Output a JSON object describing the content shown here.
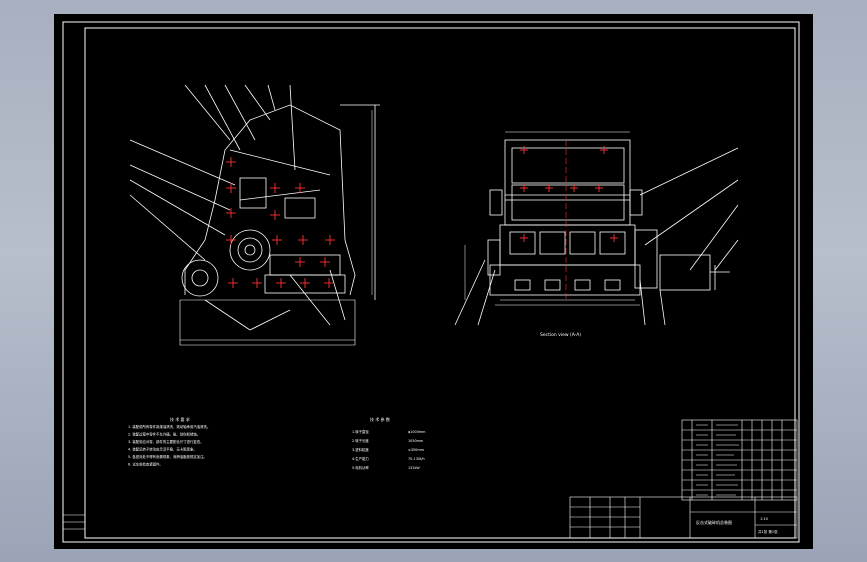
{
  "app": {
    "background_colors": [
      "#a8b0c0",
      "#9aa4b6"
    ],
    "paper_color": "#000000",
    "line_color": "#ffffff",
    "accent_color": "#ff3030"
  },
  "drawing": {
    "section_view_caption": "Section view (A-A)",
    "tech_requirements_title": "技 术 要 求",
    "tech_params_title": "技 术 参 数",
    "tech_requirements": [
      "1. 装配前所有零件用煤油清洗，滚动轴承用汽油清洗。",
      "2. 装配过程中零件不允许磕、碰、划伤和锈蚀。",
      "3. 装配前应对零、部件的主要配合尺寸进行复查。",
      "4. 装配后转子转动应灵活平稳，无卡阻现象。",
      "5. 各密封处不得有渗漏现象，润滑油脂按规定加注。",
      "6. 试车前检查紧固件。"
    ],
    "tech_params": [
      {
        "label": "1.转子直径",
        "value": "φ1000mm"
      },
      {
        "label": "2.转子长度",
        "value": "1050mm"
      },
      {
        "label": "3.进料粒度",
        "value": "≤350mm"
      },
      {
        "label": "4.生产能力",
        "value": "70-130t/h"
      },
      {
        "label": "5.电机功率",
        "value": "132kW"
      }
    ],
    "title_block": {
      "drawing_name": "反击式破碎机总装图",
      "scale": "1:10",
      "sheet": "共1张 第1张"
    }
  }
}
